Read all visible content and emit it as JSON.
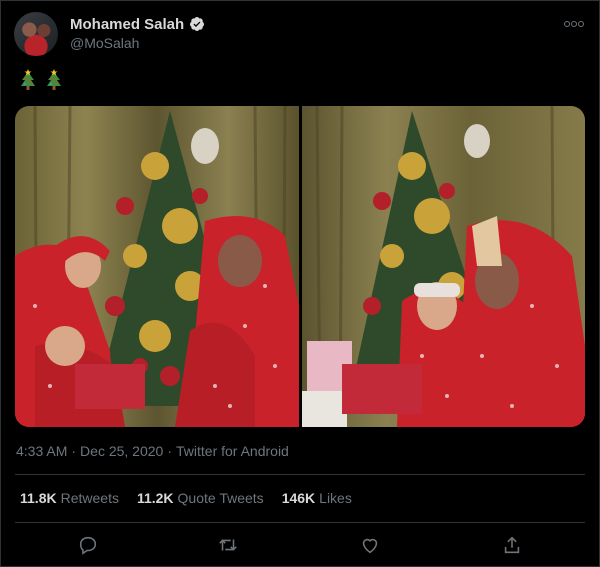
{
  "author": {
    "name": "Mohamed Salah",
    "handle": "@MoSalah",
    "verified": true
  },
  "tweet": {
    "text_emojis": [
      "christmas-tree",
      "christmas-tree"
    ],
    "media_count": 2
  },
  "meta": {
    "time": "4:33 AM",
    "separator1": "·",
    "date": "Dec 25, 2020",
    "separator2": "·",
    "source": "Twitter for Android"
  },
  "stats": {
    "retweets_value": "11.8K",
    "retweets_label": "Retweets",
    "quotes_value": "11.2K",
    "quotes_label": "Quote Tweets",
    "likes_value": "146K",
    "likes_label": "Likes"
  },
  "actions": [
    "reply-icon",
    "retweet-icon",
    "like-icon",
    "share-icon"
  ],
  "colors": {
    "background": "#000000",
    "text_primary": "#d9d9d9",
    "text_secondary": "#6e767d",
    "divider": "#2f3336",
    "verified": "#d9d9d9"
  }
}
